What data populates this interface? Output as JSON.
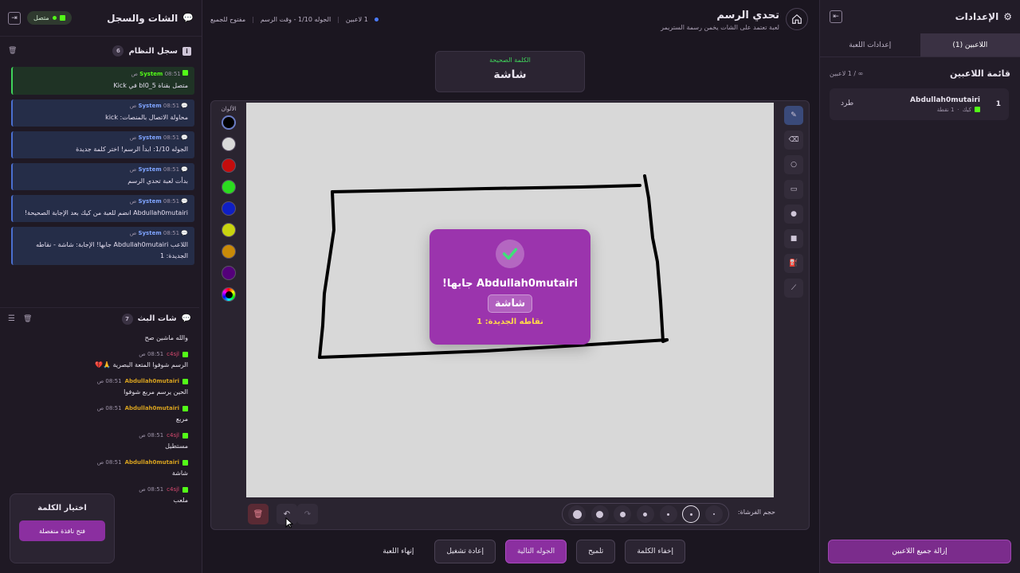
{
  "settings": {
    "title": "الإعدادات",
    "tabs": [
      {
        "label": "اللاعبين (1)",
        "active": true
      },
      {
        "label": "إعدادات اللعبة",
        "active": false
      }
    ],
    "player_list_title": "قائمة اللاعبين",
    "player_count": "∞ / 1 لاعبين",
    "players": [
      {
        "rank": "1",
        "name": "Abdullah0mutairi",
        "platform": "كيك",
        "points": "1 نقطة",
        "kick_label": "طرد"
      }
    ],
    "remove_all_label": "إزالة جميع اللاعبين"
  },
  "chat": {
    "title": "الشات والسجل",
    "status": "متصل",
    "system_log": {
      "title": "سجل النظام",
      "count": "6",
      "messages": [
        {
          "author": "System",
          "time": "08:51 ص",
          "text": "متصل بقناة bl0_5 في Kick"
        },
        {
          "author": "System",
          "time": "08:51 ص",
          "text": "محاولة الاتصال بالمنصات: kick"
        },
        {
          "author": "System",
          "time": "08:51 ص",
          "text": "الجوله 1/10: ابدأ الرسم! اختر كلمة جديدة"
        },
        {
          "author": "System",
          "time": "08:51 ص",
          "text": "بدأت لعبة تحدي الرسم"
        },
        {
          "author": "System",
          "time": "08:51 ص",
          "text": "Abdullah0mutairi انضم للعبة من كيك بعد الإجابة الصحيحة!"
        },
        {
          "author": "System",
          "time": "08:51 ص",
          "text": "اللاعب Abdullah0mutairi جابها! الإجابة: شاشة - نقاطه الجديدة: 1"
        }
      ]
    },
    "live_chat": {
      "title": "شات البث",
      "count": "7",
      "messages": [
        {
          "author": "",
          "time": "",
          "text": "والله ماشين صح"
        },
        {
          "author": "c4sjl",
          "time": "08:51 ص",
          "text": "الرسم شوفوا المتعة البصرية 🙏💔"
        },
        {
          "author": "Abdullah0mutairi",
          "time": "08:51 ص",
          "text": "الحين يرسم مربع شوفوا"
        },
        {
          "author": "Abdullah0mutairi",
          "time": "08:51 ص",
          "text": "مربع"
        },
        {
          "author": "c4sjl",
          "time": "08:51 ص",
          "text": "مستطيل"
        },
        {
          "author": "Abdullah0mutairi",
          "time": "08:51 ص",
          "text": "شاشة"
        },
        {
          "author": "c4sjl",
          "time": "08:51 ص",
          "text": "ملعب"
        }
      ]
    },
    "word_picker": {
      "title": "اختيار الكلمة",
      "button": "فتح نافذة منفصلة"
    }
  },
  "header": {
    "title": "تحدي الرسم",
    "subtitle": "لعبة تعتمد على الشات يخمن رسمة الستريمر",
    "players": "1 لاعبين",
    "round": "الجوله 1/10 - وقت الرسم",
    "mode": "مفتوح للجميع"
  },
  "word_box": {
    "label": "الكلمة الصحيحة",
    "word": "شاشة"
  },
  "board": {
    "colors_label": "الألوان",
    "colors": [
      "#000000",
      "#d9d9d9",
      "#c40d0d",
      "#2bdc1f",
      "#0f1fc4",
      "#c8d40f",
      "#c98a08",
      "#54007a"
    ],
    "brush_label": "حجم الفرشاة:",
    "tools": [
      "pencil-icon",
      "eraser-icon",
      "circle-icon",
      "rectangle-icon",
      "filled-circle-icon",
      "filled-rectangle-icon",
      "fill-bucket-icon",
      "line-icon"
    ]
  },
  "winner": {
    "message": "Abdullah0mutairi جابها!",
    "word": "شاشة",
    "points": "نقاطه الجديدة: 1"
  },
  "actions": {
    "hide_word": "إخفاء الكلمة",
    "hint": "تلميح",
    "next_round": "الجوله التالية",
    "restart": "إعادة تشغيل",
    "end_game": "إنهاء اللعبة"
  }
}
